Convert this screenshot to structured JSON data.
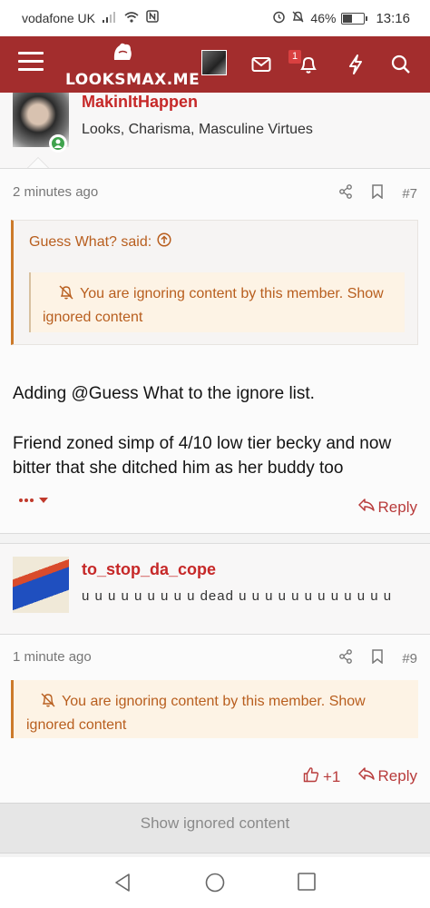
{
  "status_bar": {
    "carrier": "vodafone UK",
    "battery": "46%",
    "battery_level": 0.46,
    "time": "13:16"
  },
  "header": {
    "logo_text": "LOOKSMAX.ME",
    "notification_count": "1",
    "icons": [
      "menu-icon",
      "logo-icon",
      "avatar",
      "mail-icon",
      "bell-icon",
      "bolt-icon",
      "search-icon"
    ]
  },
  "post1": {
    "username": "MakinItHappen",
    "user_title": "Looks, Charisma, Masculine Virtues",
    "time": "2 minutes ago",
    "post_number": "#7",
    "quote_author": "Guess What? said:",
    "ignore_notice": "You are ignoring content by this member. Show ignored content",
    "text_line1": "Adding @Guess What to the ignore list.",
    "text_line2": "Friend zoned simp of 4/10 low tier becky and now bitter that she ditched him as her buddy too",
    "reply_label": "Reply"
  },
  "post2": {
    "username": "to_stop_da_cope",
    "user_title": "u u u u u u u u u dead u u u u u u u u u u u u",
    "time": "1 minute ago",
    "post_number": "#9",
    "ignore_notice": "You are ignoring content by this member. Show ignored content",
    "like_count": "+1",
    "reply_label": "Reply"
  },
  "footer": {
    "show_ignored_label": "Show ignored content"
  },
  "colors": {
    "brand": "#a32d2d",
    "username": "#c62828",
    "quote_accent": "#cc7a2a",
    "notice_bg": "#fdf3e5"
  }
}
